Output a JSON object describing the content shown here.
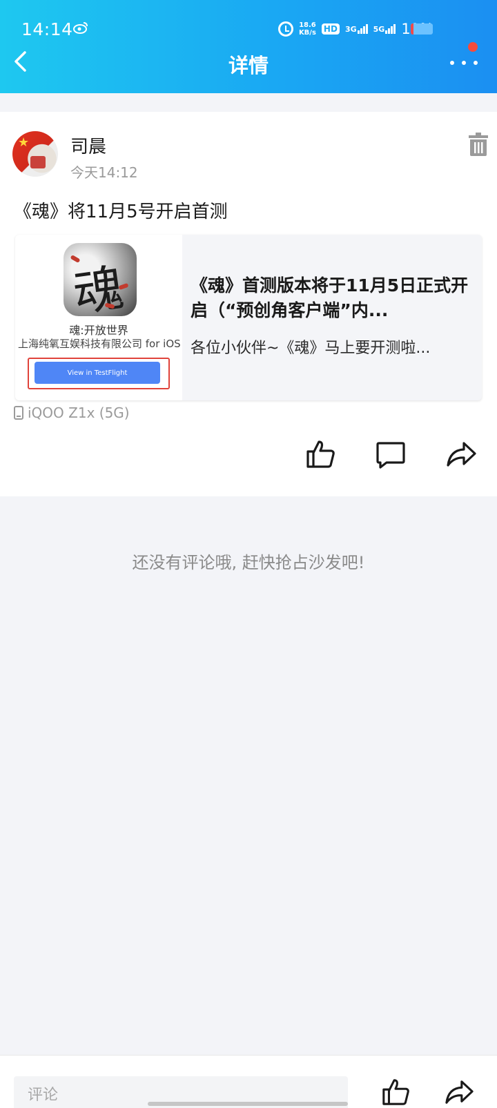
{
  "status_bar": {
    "time": "14:14",
    "speed_value": "18.6",
    "speed_unit": "KB/s",
    "hd": "HD",
    "net1": "3G",
    "net2": "5G",
    "battery_pct": "11%"
  },
  "header": {
    "title": "详情",
    "accent": "#1aa8f3"
  },
  "post": {
    "username": "司晨",
    "time": "今天14:12",
    "text": "《魂》将11月5号开启首测",
    "link_card": {
      "thumb_app_name": "魂:开放世界",
      "thumb_developer": "上海纯氧互娱科技有限公司 for iOS",
      "thumb_button": "View in TestFlight",
      "title": "《魂》首测版本将于11月5日正式开启（“预创角客户端”内...",
      "description": "各位小伙伴~《魂》马上要开测啦..."
    },
    "device": "iQOO Z1x (5G)"
  },
  "comments": {
    "empty_text": "还没有评论哦, 赶快抢占沙发吧!"
  },
  "bottom_bar": {
    "comment_placeholder": "评论"
  },
  "icons": [
    "back-icon",
    "more-icon",
    "trash-icon",
    "like-icon",
    "comment-icon",
    "share-icon",
    "phone-icon"
  ]
}
